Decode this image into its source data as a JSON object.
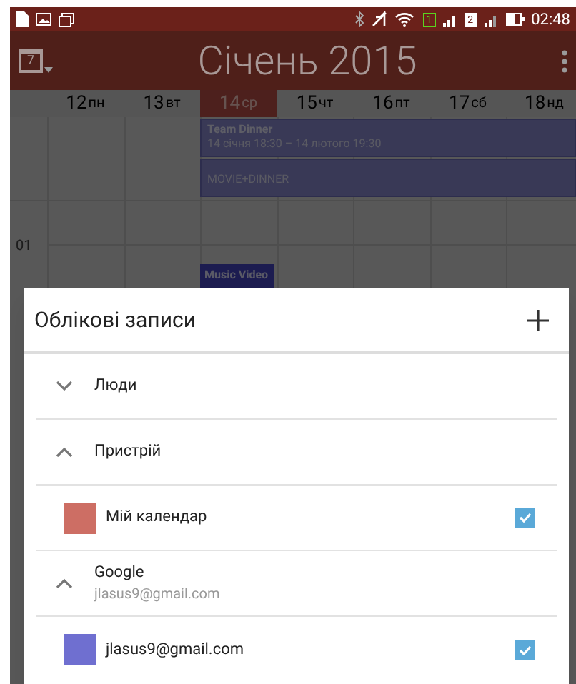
{
  "status_bar": {
    "time": "02:48",
    "sim_slots": [
      {
        "label": "1",
        "active": true
      },
      {
        "label": "2",
        "active": false
      }
    ]
  },
  "toolbar": {
    "title": "Січень 2015",
    "calendar_icon_label": "7"
  },
  "days": [
    {
      "num": "12",
      "name": "пн",
      "selected": false
    },
    {
      "num": "13",
      "name": "вт",
      "selected": false
    },
    {
      "num": "14",
      "name": "ср",
      "selected": true
    },
    {
      "num": "15",
      "name": "чт",
      "selected": false
    },
    {
      "num": "16",
      "name": "пт",
      "selected": false
    },
    {
      "num": "17",
      "name": "сб",
      "selected": false
    },
    {
      "num": "18",
      "name": "нд",
      "selected": false
    }
  ],
  "all_day_events": [
    {
      "title": "Team Dinner",
      "time": "14 січня 18:30 – 14 лютого 19:30"
    },
    {
      "title": "MOVIE+DINNER"
    }
  ],
  "hours": [
    "01"
  ],
  "timed_events": [
    {
      "title": "Music Video"
    }
  ],
  "dialog": {
    "title": "Облікові записи",
    "rows": [
      {
        "kind": "group",
        "label": "Люди",
        "expanded": false
      },
      {
        "kind": "group",
        "label": "Пристрій",
        "expanded": true
      },
      {
        "kind": "calendar",
        "label": "Мій календар",
        "color": "#cd6e64",
        "checked": true
      },
      {
        "kind": "group",
        "label": "Google",
        "sublabel": "jlasus9@gmail.com",
        "expanded": true
      },
      {
        "kind": "calendar",
        "label": "jlasus9@gmail.com",
        "color": "#6f6fd0",
        "checked": true
      }
    ]
  }
}
